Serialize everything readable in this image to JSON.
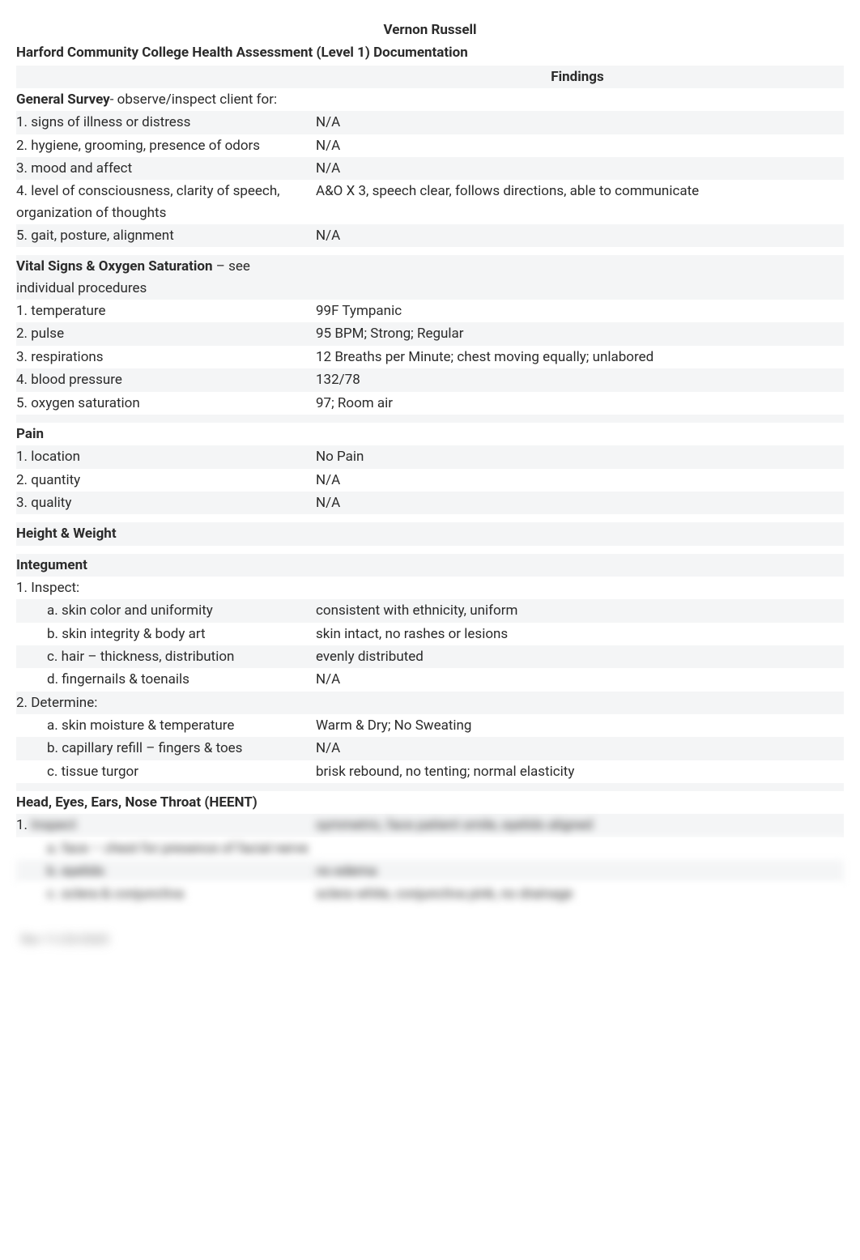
{
  "header": {
    "patient_name": "Vernon Russell",
    "doc_title": "Harford Community College Health Assessment (Level 1) Documentation",
    "findings_label": "Findings"
  },
  "sections": {
    "general_survey": {
      "title": "General Survey",
      "suffix": "- observe/inspect client for:",
      "items": [
        {
          "label": "1.  signs of illness or distress",
          "finding": "N/A"
        },
        {
          "label": "2.  hygiene, grooming, presence of odors",
          "finding": "N/A"
        },
        {
          "label": "3.  mood and affect",
          "finding": "N/A"
        },
        {
          "label": "4.  level of consciousness, clarity of speech, organization of thoughts",
          "finding": "A&O X 3, speech clear, follows directions, able to communicate"
        },
        {
          "label": "5.  gait, posture, alignment",
          "finding": "N/A"
        }
      ]
    },
    "vitals": {
      "title": "Vital Signs & Oxygen Saturation",
      "suffix": " – see individual procedures",
      "items": [
        {
          "label": "1.  temperature",
          "finding": "99F Tympanic"
        },
        {
          "label": "2.  pulse",
          "finding": "95 BPM; Strong; Regular"
        },
        {
          "label": "3.  respirations",
          "finding": "12 Breaths per Minute; chest moving equally; unlabored"
        },
        {
          "label": "4.  blood pressure",
          "finding": "132/78"
        },
        {
          "label": "5.  oxygen saturation",
          "finding": "97; Room air"
        }
      ]
    },
    "pain": {
      "title": "Pain",
      "items": [
        {
          "label": "1.  location",
          "finding": "No Pain"
        },
        {
          "label": "2.  quantity",
          "finding": "N/A"
        },
        {
          "label": "3.  quality",
          "finding": "N/A"
        }
      ]
    },
    "height_weight": {
      "title": "Height & Weight"
    },
    "integument": {
      "title": "Integument",
      "inspect_label": "1. Inspect:",
      "inspect_items": [
        {
          "label": "a.  skin color and uniformity",
          "finding": "consistent with ethnicity, uniform"
        },
        {
          "label": "b.  skin integrity & body art",
          "finding": "skin intact, no rashes or lesions"
        },
        {
          "label": "c.  hair – thickness, distribution",
          "finding": "evenly distributed"
        },
        {
          "label": "d.  fingernails & toenails",
          "finding": "N/A"
        }
      ],
      "determine_label": "2.  Determine:",
      "determine_items": [
        {
          "label": "a.  skin moisture & temperature",
          "finding": "Warm & Dry; No Sweating"
        },
        {
          "label": "b.  capillary refill – fingers & toes",
          "finding": "N/A"
        },
        {
          "label": "c.  tissue turgor",
          "finding": "brisk rebound, no tenting; normal elasticity"
        }
      ]
    },
    "heent": {
      "title": "Head, Eyes, Ears, Nose Throat (HEENT)",
      "num_prefix": "1.",
      "blurred": [
        {
          "left": "Inspect",
          "right": "symmetric, face patient smile, eyelids aligned"
        },
        {
          "left": "a. face – chest for presence of facial nerve",
          "right": ""
        },
        {
          "left": "b. eyelids",
          "right": "no edema"
        },
        {
          "left": "c. sclera & conjunctiva",
          "right": "sclera white, conjunctiva pink, no drainage"
        }
      ]
    }
  },
  "footer_blur": "Rev 11/23/2020"
}
